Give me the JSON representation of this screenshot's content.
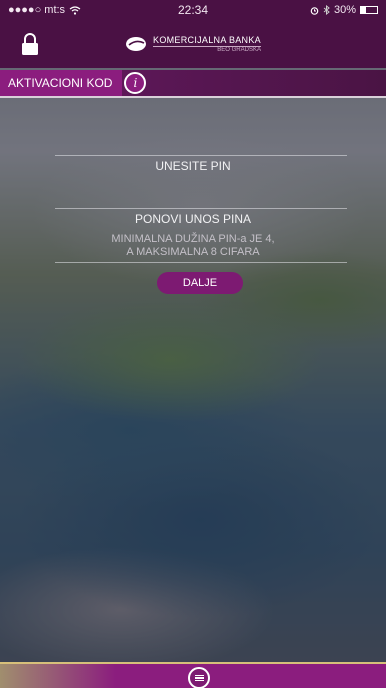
{
  "status_bar": {
    "carrier": "●●●●○ mt:s",
    "time": "22:34",
    "battery_text": "30%",
    "battery_level": 0.3
  },
  "header": {
    "brand_name": "KOMERCIJALNA BANKA",
    "brand_sub": "BEO GRADSKA"
  },
  "title_bar": {
    "title": "AKTIVACIONI KOD",
    "info_glyph": "i"
  },
  "form": {
    "pin_label": "UNESITE PIN",
    "repeat_pin_label": "PONOVI UNOS PINA",
    "hint_line1": "MINIMALNA DUŽINA PIN-a JE 4,",
    "hint_line2": "A MAKSIMALNA 8 CIFARA",
    "next_button": "DALJE"
  },
  "colors": {
    "brand_purple": "#8b1d7e",
    "header_dark": "#4a1144"
  },
  "icons": [
    "lock-icon",
    "wifi-icon",
    "alarm-icon",
    "bluetooth-icon",
    "battery-icon",
    "info-icon",
    "menu-icon"
  ]
}
